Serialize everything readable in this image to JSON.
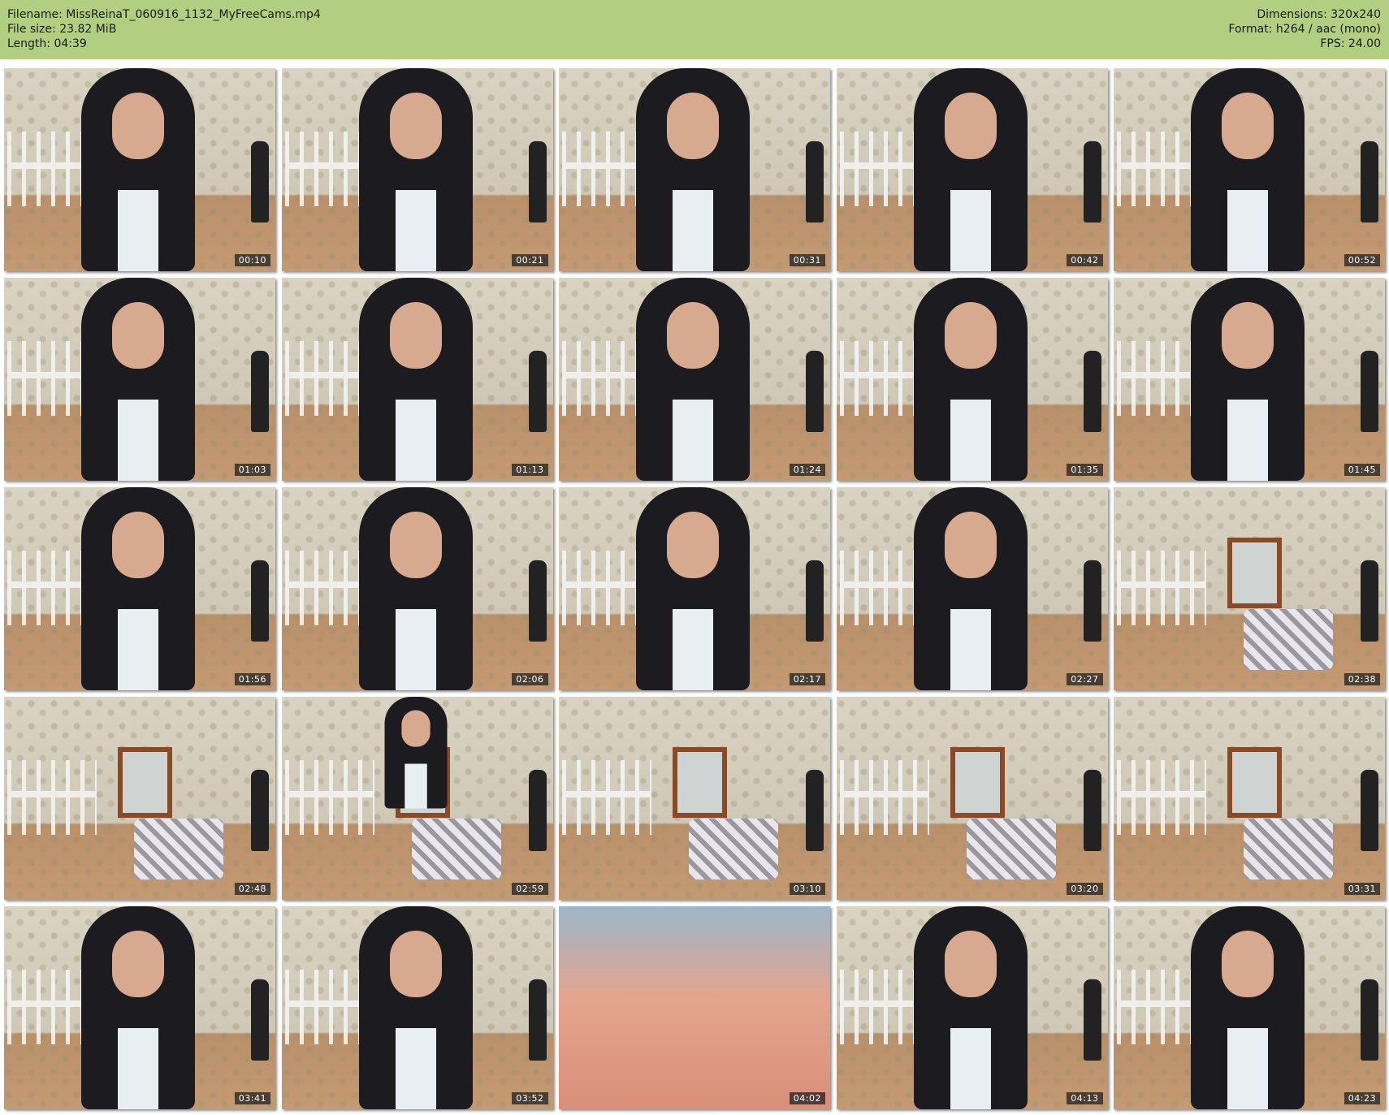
{
  "header": {
    "filename": "Filename: MissReinaT_060916_1132_MyFreeCams.mp4",
    "filesize": "File size: 23.82 MiB",
    "length": "Length: 04:39",
    "dimensions": "Dimensions: 320x240",
    "format": "Format: h264 / aac (mono)",
    "fps": "FPS: 24.00"
  },
  "thumbnails": [
    {
      "time": "00:10",
      "scene": "person"
    },
    {
      "time": "00:21",
      "scene": "person"
    },
    {
      "time": "00:31",
      "scene": "person"
    },
    {
      "time": "00:42",
      "scene": "person"
    },
    {
      "time": "00:52",
      "scene": "person"
    },
    {
      "time": "01:03",
      "scene": "person"
    },
    {
      "time": "01:13",
      "scene": "person"
    },
    {
      "time": "01:24",
      "scene": "person"
    },
    {
      "time": "01:35",
      "scene": "person"
    },
    {
      "time": "01:45",
      "scene": "person"
    },
    {
      "time": "01:56",
      "scene": "person"
    },
    {
      "time": "02:06",
      "scene": "person"
    },
    {
      "time": "02:17",
      "scene": "person"
    },
    {
      "time": "02:27",
      "scene": "person"
    },
    {
      "time": "02:38",
      "scene": "room"
    },
    {
      "time": "02:48",
      "scene": "room"
    },
    {
      "time": "02:59",
      "scene": "room-person"
    },
    {
      "time": "03:10",
      "scene": "room"
    },
    {
      "time": "03:20",
      "scene": "room"
    },
    {
      "time": "03:31",
      "scene": "room"
    },
    {
      "time": "03:41",
      "scene": "person"
    },
    {
      "time": "03:52",
      "scene": "person"
    },
    {
      "time": "04:02",
      "scene": "closeup"
    },
    {
      "time": "04:13",
      "scene": "person"
    },
    {
      "time": "04:23",
      "scene": "person"
    }
  ]
}
